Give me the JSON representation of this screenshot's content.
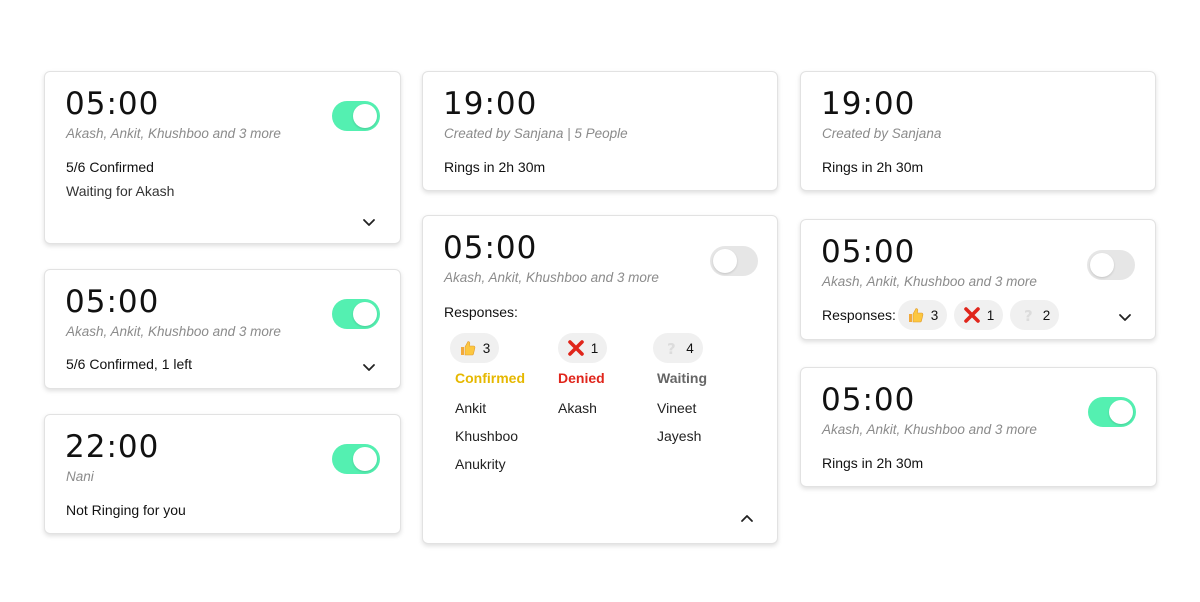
{
  "cards": {
    "c1": {
      "time": "05:00",
      "members": "Akash, Ankit, Khushboo and 3 more",
      "confirmed": "5/6 Confirmed",
      "waiting": "Waiting for Akash"
    },
    "c2": {
      "time": "05:00",
      "members": "Akash, Ankit, Khushboo and 3 more",
      "status": "5/6 Confirmed, 1 left"
    },
    "c3": {
      "time": "22:00",
      "creator": "Nani",
      "status": "Not Ringing for you"
    },
    "c4": {
      "time": "19:00",
      "meta": "Created by Sanjana | 5 People",
      "rings": "Rings in 2h 30m"
    },
    "c5": {
      "time": "05:00",
      "members": "Akash, Ankit, Khushboo and 3 more",
      "responses_label": "Responses:",
      "confirmed": {
        "count": "3",
        "label": "Confirmed",
        "names": [
          "Ankit",
          "Khushboo",
          "Anukrity"
        ]
      },
      "denied": {
        "count": "1",
        "label": "Denied",
        "names": [
          "Akash"
        ]
      },
      "waiting": {
        "count": "4",
        "label": "Waiting",
        "names": [
          "Vineet",
          "Jayesh"
        ]
      }
    },
    "c6": {
      "time": "19:00",
      "meta": "Created by Sanjana",
      "rings": "Rings in 2h 30m"
    },
    "c7": {
      "time": "05:00",
      "members": "Akash, Ankit, Khushboo and 3 more",
      "responses_label": "Responses:",
      "thumbs_count": "3",
      "cross_count": "1",
      "question_count": "2"
    },
    "c8": {
      "time": "05:00",
      "members": "Akash, Ankit, Khushboo and 3 more",
      "rings": "Rings in 2h 30m"
    }
  },
  "colors": {
    "toggle_on": "#54f0b1",
    "toggle_off": "#e6e6e6",
    "confirmed": "#e6b800",
    "denied": "#e0251b",
    "waiting": "#666666"
  },
  "icons": [
    "thumbs-up-icon",
    "cross-icon",
    "question-icon",
    "chevron-down-icon",
    "chevron-up-icon"
  ]
}
